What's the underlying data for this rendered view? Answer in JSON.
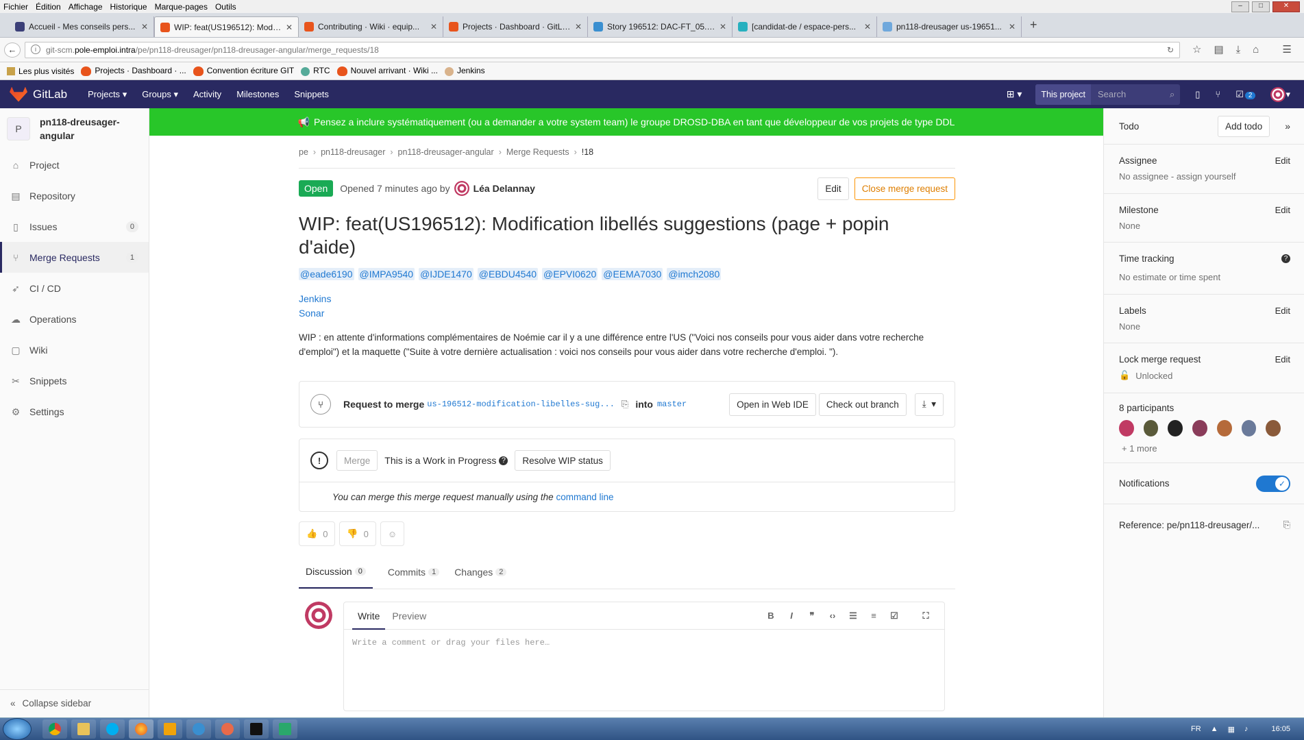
{
  "browser": {
    "menu": [
      "Fichier",
      "Édition",
      "Affichage",
      "Historique",
      "Marque-pages",
      "Outils"
    ],
    "tabs": [
      {
        "title": "Accueil - Mes conseils pers...",
        "icon_color": "#3b3f78",
        "active": false
      },
      {
        "title": "WIP: feat(US196512): Modif...",
        "icon_color": "#e8541c",
        "active": true
      },
      {
        "title": "Contributing · Wiki · equip...",
        "icon_color": "#e8541c",
        "active": false
      },
      {
        "title": "Projects · Dashboard · GitLab",
        "icon_color": "#e8541c",
        "active": false
      },
      {
        "title": "Story 196512: DAC-FT_05.2...",
        "icon_color": "#3a8fd0",
        "active": false
      },
      {
        "title": "[candidat-de / espace-pers...",
        "icon_color": "#27b0bf",
        "active": false
      },
      {
        "title": "pn118-dreusager us-19651...",
        "icon_color": "#6fa8dc",
        "active": false
      }
    ],
    "url_prefix": "git-scm.",
    "url_host": "pole-emploi.intra",
    "url_path": "/pe/pn118-dreusager/pn118-dreusager-angular/merge_requests/18",
    "bookmarks": [
      "Les plus visités",
      "Projects · Dashboard · ...",
      "Convention écriture GIT",
      "RTC",
      "Nouvel arrivant · Wiki ...",
      "Jenkins"
    ]
  },
  "nav": {
    "brand": "GitLab",
    "links": [
      "Projects",
      "Groups",
      "Activity",
      "Milestones",
      "Snippets"
    ],
    "scope": "This project",
    "search_placeholder": "Search",
    "todo_count": "2"
  },
  "sidebar": {
    "avatar_letter": "P",
    "project_name": "pn118-dreusager-angular",
    "items": [
      {
        "label": "Project",
        "icon": "home-icon"
      },
      {
        "label": "Repository",
        "icon": "book-icon"
      },
      {
        "label": "Issues",
        "icon": "issues-icon",
        "count": "0"
      },
      {
        "label": "Merge Requests",
        "icon": "merge-request-icon",
        "count": "1"
      },
      {
        "label": "CI / CD",
        "icon": "rocket-icon"
      },
      {
        "label": "Operations",
        "icon": "cloud-icon"
      },
      {
        "label": "Wiki",
        "icon": "wiki-icon"
      },
      {
        "label": "Snippets",
        "icon": "scissors-icon"
      },
      {
        "label": "Settings",
        "icon": "gear-icon"
      }
    ],
    "collapse_label": "Collapse sidebar"
  },
  "banner": "Pensez a inclure systématiquement (ou a demander a votre system team) le groupe DROSD-DBA en tant que développeur de vos projets de type DDL",
  "breadcrumb": [
    "pe",
    "pn118-dreusager",
    "pn118-dreusager-angular",
    "Merge Requests",
    "!18"
  ],
  "mr": {
    "status": "Open",
    "opened_text": "Opened 7 minutes ago by",
    "author": "Léa Delannay",
    "edit_label": "Edit",
    "close_label": "Close merge request",
    "title": "WIP: feat(US196512): Modification libellés suggestions (page + popin d'aide)",
    "mentions": [
      "@eade6190",
      "@IMPA9540",
      "@IJDE1470",
      "@EBDU4540",
      "@EPVI0620",
      "@EEMA7030",
      "@imch2080"
    ],
    "links": [
      "Jenkins",
      "Sonar"
    ],
    "description": "WIP : en attente d'informations complémentaires de Noémie car il y a une différence entre l'US (\"Voici nos conseils pour vous aider dans votre recherche d'emploi\") et la maquette (\"Suite à votre dernière actualisation : voici nos conseils pour vous aider dans votre recherche d'emploi. \").",
    "request_label": "Request to merge",
    "source_branch": "us-196512-modification-libelles-sug...",
    "into_label": "into",
    "target_branch": "master",
    "web_ide_label": "Open in Web IDE",
    "checkout_label": "Check out branch",
    "merge_label": "Merge",
    "wip_text": "This is a Work in Progress",
    "resolve_label": "Resolve WIP status",
    "manual_text": "You can merge this merge request manually using the",
    "command_line": "command line",
    "thumbs_up": "0",
    "thumbs_down": "0"
  },
  "tabs": [
    {
      "label": "Discussion",
      "count": "0"
    },
    {
      "label": "Commits",
      "count": "1"
    },
    {
      "label": "Changes",
      "count": "2"
    }
  ],
  "comment": {
    "write_label": "Write",
    "preview_label": "Preview",
    "placeholder": "Write a comment or drag your files here…",
    "tools": [
      "B",
      "I",
      "❞",
      "‹›",
      "☰",
      "≡",
      "☑"
    ]
  },
  "right": {
    "todo_label": "Todo",
    "add_todo": "Add todo",
    "assignee_label": "Assignee",
    "assignee_value": "No assignee - assign yourself",
    "milestone_label": "Milestone",
    "milestone_value": "None",
    "time_label": "Time tracking",
    "time_value": "No estimate or time spent",
    "labels_label": "Labels",
    "labels_value": "None",
    "lock_label": "Lock merge request",
    "lock_value": "Unlocked",
    "edit_label": "Edit",
    "participants_label": "8 participants",
    "more_label": "+ 1 more",
    "notifications_label": "Notifications",
    "reference": "Reference: pe/pn118-dreusager/...",
    "participant_colors": [
      "#c03a63",
      "#5a5a3a",
      "#222222",
      "#8a3c5a",
      "#b56a3a",
      "#6a7a9a",
      "#8a5a3a"
    ]
  },
  "taskbar": {
    "lang": "FR",
    "time": "16:05"
  },
  "colors": {
    "nav_bg": "#292961",
    "banner_bg": "#28c629",
    "open_badge": "#1aaa55",
    "close_button": "#fc9403",
    "link": "#1f78d1"
  }
}
